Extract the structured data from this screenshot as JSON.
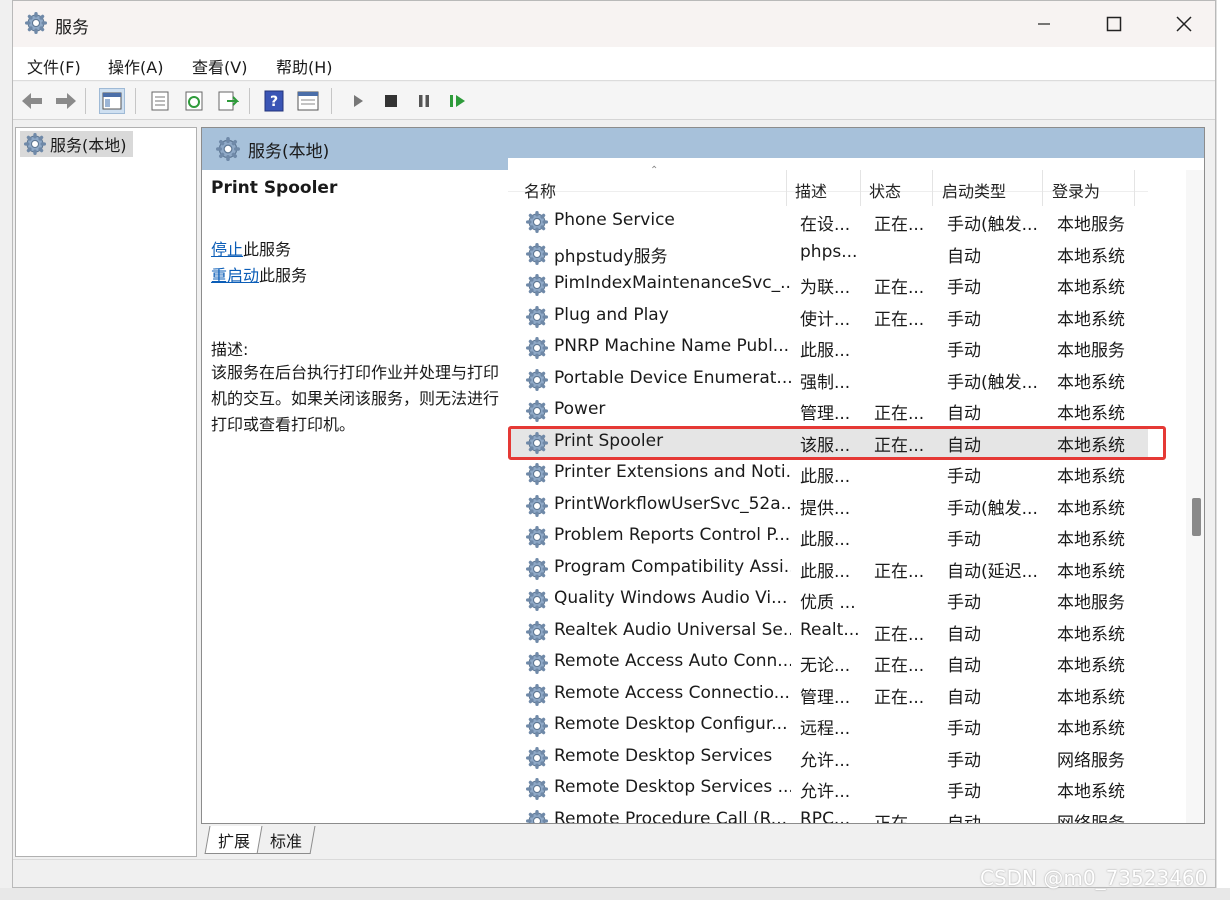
{
  "window": {
    "title": "服务"
  },
  "menu": [
    "文件(F)",
    "操作(A)",
    "查看(V)",
    "帮助(H)"
  ],
  "toolbar": {
    "icons": [
      "back-icon",
      "forward-icon",
      "show-hide-tree-icon",
      "properties-icon",
      "refresh-icon",
      "export-list-icon",
      "help-icon",
      "view-icon",
      "start-service-icon",
      "stop-service-icon",
      "pause-service-icon",
      "resume-service-icon"
    ]
  },
  "tree": {
    "root_label": "服务(本地)"
  },
  "main": {
    "header_title": "服务(本地)"
  },
  "selected_service": {
    "name": "Print Spooler",
    "stop_link": "停止",
    "stop_suffix": "此服务",
    "restart_link": "重启动",
    "restart_suffix": "此服务",
    "desc_label": "描述:",
    "description": "该服务在后台执行打印作业并处理与打印机的交互。如果关闭该服务，则无法进行打印或查看打印机。"
  },
  "columns": {
    "name": "名称",
    "desc": "描述",
    "status": "状态",
    "startup": "启动类型",
    "logon": "登录为"
  },
  "services": [
    {
      "name": "Phone Service",
      "desc": "在设...",
      "status": "正在...",
      "startup": "手动(触发...",
      "logon": "本地服务"
    },
    {
      "name": "phpstudy服务",
      "desc": "phps...",
      "status": "",
      "startup": "自动",
      "logon": "本地系统"
    },
    {
      "name": "PimIndexMaintenanceSvc_...",
      "desc": "为联...",
      "status": "正在...",
      "startup": "手动",
      "logon": "本地系统"
    },
    {
      "name": "Plug and Play",
      "desc": "使计...",
      "status": "正在...",
      "startup": "手动",
      "logon": "本地系统"
    },
    {
      "name": "PNRP Machine Name Publ...",
      "desc": "此服...",
      "status": "",
      "startup": "手动",
      "logon": "本地服务"
    },
    {
      "name": "Portable Device Enumerat...",
      "desc": "强制...",
      "status": "",
      "startup": "手动(触发...",
      "logon": "本地系统"
    },
    {
      "name": "Power",
      "desc": "管理...",
      "status": "正在...",
      "startup": "自动",
      "logon": "本地系统"
    },
    {
      "name": "Print Spooler",
      "desc": "该服...",
      "status": "正在...",
      "startup": "自动",
      "logon": "本地系统",
      "selected": true
    },
    {
      "name": "Printer Extensions and Noti...",
      "desc": "此服...",
      "status": "",
      "startup": "手动",
      "logon": "本地系统"
    },
    {
      "name": "PrintWorkflowUserSvc_52a...",
      "desc": "提供...",
      "status": "",
      "startup": "手动(触发...",
      "logon": "本地系统"
    },
    {
      "name": "Problem Reports Control P...",
      "desc": "此服...",
      "status": "",
      "startup": "手动",
      "logon": "本地系统"
    },
    {
      "name": "Program Compatibility Assi...",
      "desc": "此服...",
      "status": "正在...",
      "startup": "自动(延迟...",
      "logon": "本地系统"
    },
    {
      "name": "Quality Windows Audio Vi...",
      "desc": "优质 ...",
      "status": "",
      "startup": "手动",
      "logon": "本地服务"
    },
    {
      "name": "Realtek Audio Universal Se...",
      "desc": "Realt...",
      "status": "正在...",
      "startup": "自动",
      "logon": "本地系统"
    },
    {
      "name": "Remote Access Auto Conn...",
      "desc": "无论...",
      "status": "正在...",
      "startup": "自动",
      "logon": "本地系统"
    },
    {
      "name": "Remote Access Connectio...",
      "desc": "管理...",
      "status": "正在...",
      "startup": "自动",
      "logon": "本地系统"
    },
    {
      "name": "Remote Desktop Configur...",
      "desc": "远程...",
      "status": "",
      "startup": "手动",
      "logon": "本地系统"
    },
    {
      "name": "Remote Desktop Services",
      "desc": "允许...",
      "status": "",
      "startup": "手动",
      "logon": "网络服务"
    },
    {
      "name": "Remote Desktop Services ...",
      "desc": "允许...",
      "status": "",
      "startup": "手动",
      "logon": "本地系统"
    },
    {
      "name": "Remote Procedure Call (R...",
      "desc": "RPC...",
      "status": "正在...",
      "startup": "自动",
      "logon": "网络服务"
    }
  ],
  "tabs": [
    "扩展",
    "标准"
  ],
  "watermark": "CSDN @m0_73523460",
  "colors": {
    "header_bg": "#a7c1da",
    "link": "#0b5db7",
    "highlight": "#e53935",
    "selected_row": "#e5e5e5"
  }
}
